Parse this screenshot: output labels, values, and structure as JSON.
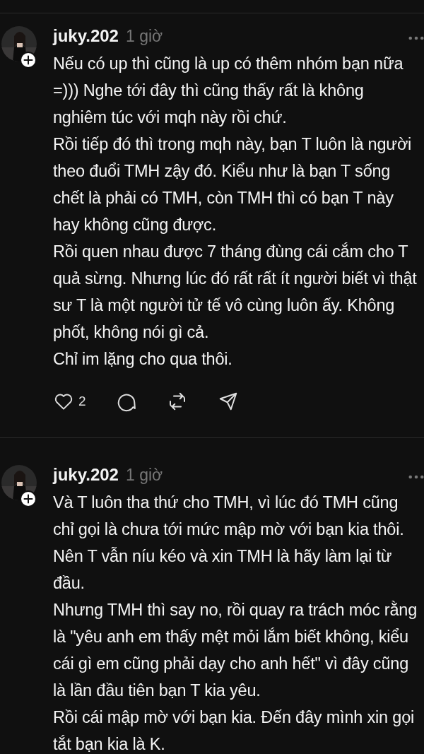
{
  "posts": [
    {
      "username": "juky.202",
      "time": "1 giờ",
      "paragraphs": [
        "Nếu có up thì cũng là up có thêm nhóm bạn nữa =))) Nghe tới đây thì cũng thấy rất là không nghiêm túc với mqh này rồi chứ.",
        "Rồi tiếp đó thì trong mqh này, bạn T luôn là người theo đuổi TMH zậy đó. Kiểu như là bạn T sống chết là phải có TMH, còn TMH thì có bạn T này hay không cũng được.",
        "Rồi quen nhau được 7 tháng đùng cái cắm cho T quả sừng. Nhưng lúc đó rất rất ít người biết vì thật sư T là một người tử tế vô cùng luôn ấy. Không phốt, không nói gì cả.",
        "Chỉ im lặng cho qua thôi."
      ],
      "actions": {
        "likes": "2"
      }
    },
    {
      "username": "juky.202",
      "time": "1 giờ",
      "paragraphs": [
        "Và T luôn tha thứ cho TMH, vì lúc đó TMH cũng chỉ gọi là chưa tới mức mập mờ với bạn kia thôi. Nên T vẫn níu kéo và xin TMH là hãy làm lại từ đầu.",
        "Nhưng TMH thì say no, rồi quay ra trách móc rằng là \"yêu anh em thấy mệt mỏi lắm biết không, kiểu cái gì em cũng phải dạy cho anh hết\" vì đây cũng là lần đầu tiên bạn T kia yêu.",
        "Rồi cái mập mờ với bạn kia. Đến đây mình xin gọi tắt bạn kia là K."
      ]
    }
  ]
}
